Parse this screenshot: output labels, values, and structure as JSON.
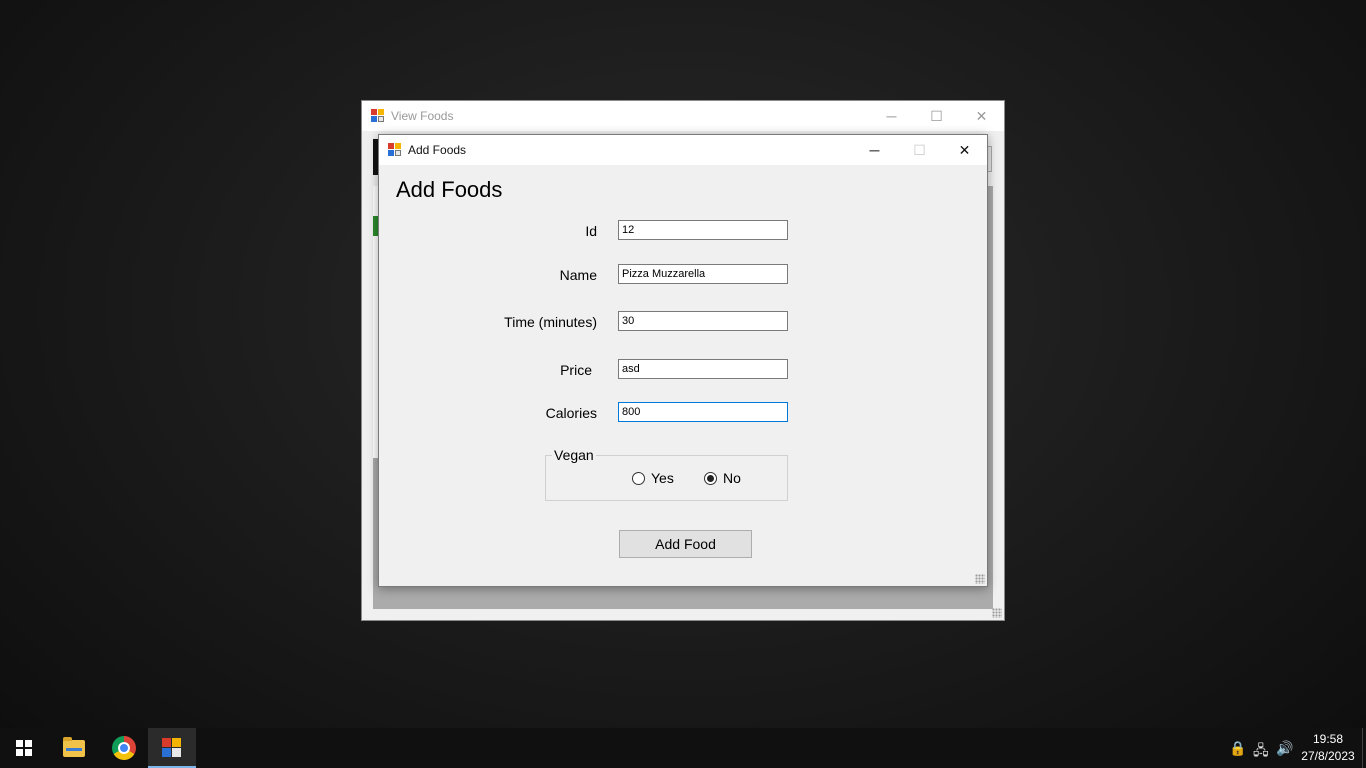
{
  "back_window": {
    "title": "View Foods",
    "caption": {
      "minimize": "─",
      "maximize": "☐",
      "close": "✕"
    }
  },
  "add_window": {
    "title": "Add Foods",
    "caption": {
      "minimize": "─",
      "maximize": "☐",
      "close": "✕"
    },
    "heading": "Add Foods",
    "fields": {
      "id": {
        "label": "Id",
        "value": "12"
      },
      "name": {
        "label": "Name",
        "value": "Pizza Muzzarella"
      },
      "time": {
        "label": "Time (minutes)",
        "value": "30"
      },
      "price": {
        "label": "Price",
        "value": "asd"
      },
      "calories": {
        "label": "Calories",
        "value": "800"
      }
    },
    "vegan": {
      "legend": "Vegan",
      "options": [
        {
          "label": "Yes",
          "checked": false
        },
        {
          "label": "No",
          "checked": true
        }
      ]
    },
    "submit_label": "Add Food"
  },
  "taskbar": {
    "time": "19:58",
    "date": "27/8/2023",
    "pinned": [
      "start-icon",
      "file-explorer-icon",
      "chrome-icon",
      "foods-app-icon"
    ],
    "tray": {
      "lock": "🔒",
      "network": "🖧",
      "volume": "🔊"
    }
  },
  "colors": {
    "focus_border": "#0078d7",
    "taskbar": "#101010",
    "window_bg": "#f0f0f0"
  }
}
